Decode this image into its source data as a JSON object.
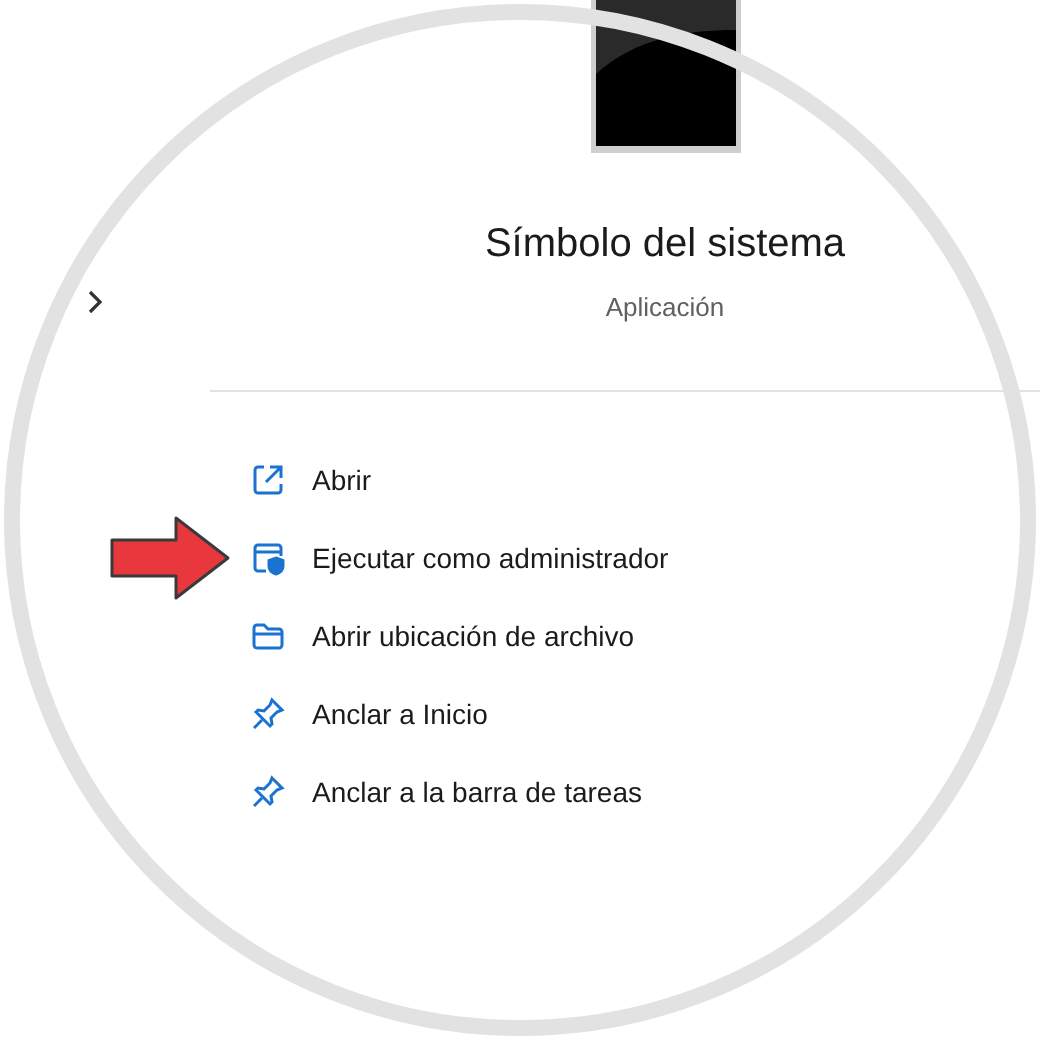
{
  "app": {
    "title": "Símbolo del sistema",
    "subtitle": "Aplicación"
  },
  "actions": [
    {
      "label": "Abrir",
      "kind": "open",
      "highlighted": false
    },
    {
      "label": "Ejecutar como administrador",
      "kind": "admin",
      "highlighted": true
    },
    {
      "label": "Abrir ubicación de archivo",
      "kind": "folder",
      "highlighted": false
    },
    {
      "label": "Anclar a Inicio",
      "kind": "pin",
      "highlighted": false
    },
    {
      "label": "Anclar a la barra de tareas",
      "kind": "pin",
      "highlighted": false
    }
  ]
}
